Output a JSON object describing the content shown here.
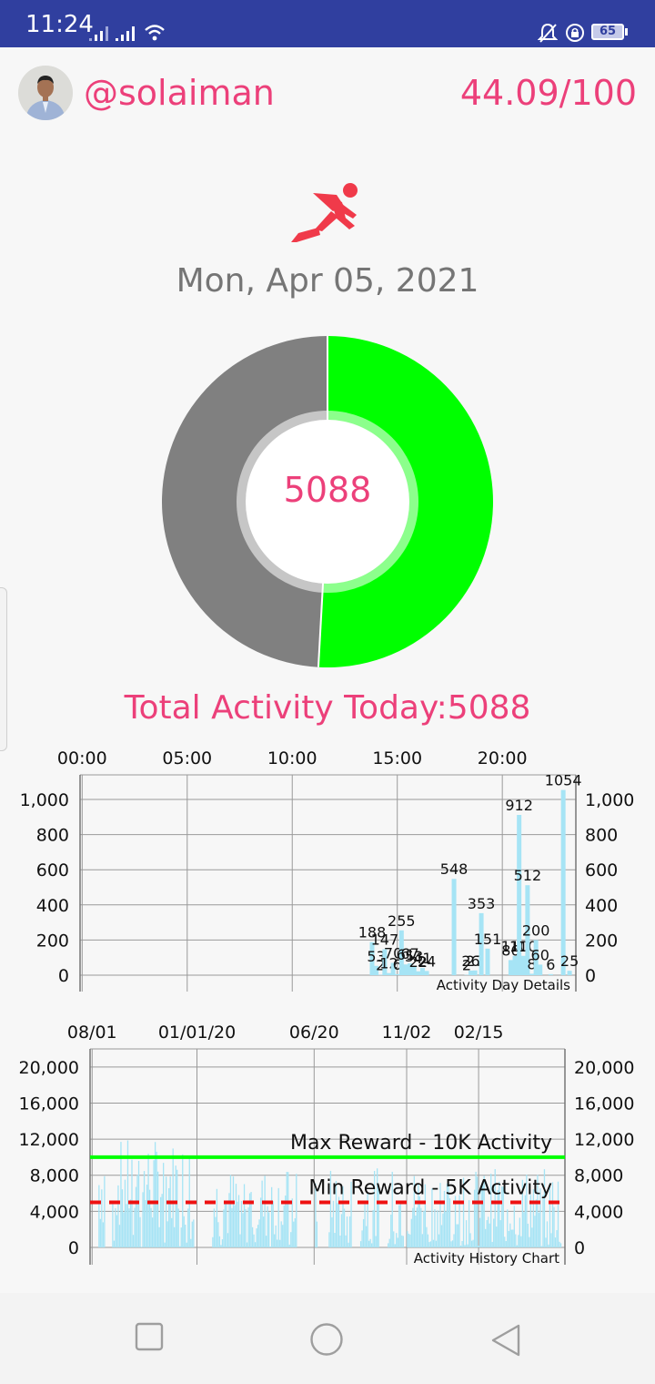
{
  "status_bar": {
    "time": "11:24",
    "battery": "65"
  },
  "header": {
    "username": "@solaiman",
    "score": "44.09/100"
  },
  "date": "Mon, Apr 05, 2021",
  "donut": {
    "center_value": "5088",
    "fraction_complete": 0.5088,
    "complete_color": "#00ff00",
    "remaining_color": "#808080"
  },
  "total_label": "Total Activity Today:5088",
  "chart_data": [
    {
      "type": "bar",
      "description": "Activity Day Details",
      "corner_label": "Activity Day Details",
      "x_tick_labels": [
        "00:00",
        "05:00",
        "10:00",
        "15:00",
        "20:00"
      ],
      "x_tick_hours": [
        0,
        5,
        10,
        15,
        20
      ],
      "xlim_hours": [
        -0.1,
        23.5
      ],
      "y_ticks": [
        0,
        200,
        400,
        600,
        800,
        1000
      ],
      "y_tick_labels": [
        "0",
        "200",
        "400",
        "600",
        "800",
        "1,000"
      ],
      "ylim": [
        0,
        1140
      ],
      "bar_color": "#a6e4f5",
      "bars": [
        {
          "hour": 13.8,
          "value": 188,
          "label": "188"
        },
        {
          "hour": 14.0,
          "value": 53,
          "label": "53"
        },
        {
          "hour": 14.2,
          "value": 2,
          "label": "2"
        },
        {
          "hour": 14.4,
          "value": 147,
          "label": "147"
        },
        {
          "hour": 14.6,
          "value": 12,
          "label": "12"
        },
        {
          "hour": 14.8,
          "value": 70,
          "label": "70"
        },
        {
          "hour": 15.0,
          "value": 6,
          "label": "6"
        },
        {
          "hour": 15.2,
          "value": 255,
          "label": "255"
        },
        {
          "hour": 15.4,
          "value": 61,
          "label": "61"
        },
        {
          "hour": 15.6,
          "value": 67,
          "label": "67"
        },
        {
          "hour": 15.8,
          "value": 53,
          "label": "53"
        },
        {
          "hour": 16.0,
          "value": 22,
          "label": "22"
        },
        {
          "hour": 16.2,
          "value": 41,
          "label": "41"
        },
        {
          "hour": 16.4,
          "value": 24,
          "label": "24"
        },
        {
          "hour": 17.7,
          "value": 548,
          "label": "548"
        },
        {
          "hour": 18.3,
          "value": 2,
          "label": "2"
        },
        {
          "hour": 18.5,
          "value": 26,
          "label": "26"
        },
        {
          "hour": 18.7,
          "value": 27,
          "label": "27"
        },
        {
          "hour": 19.0,
          "value": 353,
          "label": "353"
        },
        {
          "hour": 19.3,
          "value": 151,
          "label": "151"
        },
        {
          "hour": 20.4,
          "value": 86,
          "label": "86"
        },
        {
          "hour": 20.6,
          "value": 110,
          "label": "110"
        },
        {
          "hour": 20.8,
          "value": 912,
          "label": "912"
        },
        {
          "hour": 21.0,
          "value": 110,
          "label": "110"
        },
        {
          "hour": 21.2,
          "value": 512,
          "label": "512"
        },
        {
          "hour": 21.4,
          "value": 8,
          "label": "8"
        },
        {
          "hour": 21.6,
          "value": 200,
          "label": "200"
        },
        {
          "hour": 21.8,
          "value": 60,
          "label": "60"
        },
        {
          "hour": 22.3,
          "value": 6,
          "label": "6"
        },
        {
          "hour": 22.9,
          "value": 1054,
          "label": "1054"
        },
        {
          "hour": 23.2,
          "value": 25,
          "label": "25"
        }
      ]
    },
    {
      "type": "bar",
      "description": "Activity History Chart",
      "corner_label": "Activity History Chart",
      "x_tick_labels": [
        "08/01",
        "01/01/20",
        "06/20",
        "11/02",
        "02/15"
      ],
      "x_tick_days": [
        0,
        153,
        324,
        459,
        564
      ],
      "xlim_days": [
        -3,
        690
      ],
      "y_ticks": [
        0,
        4000,
        8000,
        12000,
        16000,
        20000
      ],
      "y_tick_labels": [
        "0",
        "4,000",
        "8,000",
        "12,000",
        "16,000",
        "20,000"
      ],
      "ylim": [
        0,
        22000
      ],
      "bar_color": "#a6e4f5",
      "reference_lines": [
        {
          "label": "Max Reward - 10K Activity",
          "value": 10000,
          "color": "#00ff00",
          "style": "solid"
        },
        {
          "label": "Min Reward - 5K Activity",
          "value": 5000,
          "color": "#ee1111",
          "style": "dashed"
        }
      ]
    }
  ]
}
